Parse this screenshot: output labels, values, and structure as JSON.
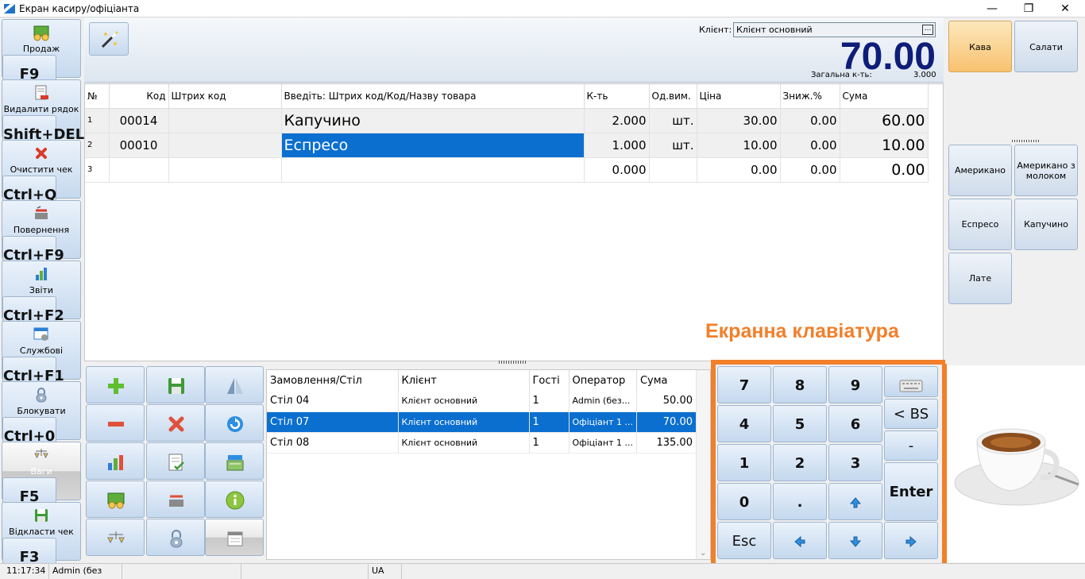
{
  "window": {
    "title": "Екран касиру/офіціанта",
    "minimize": "—",
    "restore": "❐",
    "close": "✕"
  },
  "left_buttons": [
    {
      "label": "Продаж",
      "key": "F9"
    },
    {
      "label": "Видалити рядок",
      "key": "Shift+DEL"
    },
    {
      "label": "Очистити чек",
      "key": "Ctrl+Q"
    },
    {
      "label": "Повернення",
      "key": "Ctrl+F9"
    },
    {
      "label": "Звіти",
      "key": "Ctrl+F2"
    },
    {
      "label": "Службові",
      "key": "Ctrl+F1"
    },
    {
      "label": "Блокувати",
      "key": "Ctrl+0"
    },
    {
      "label": "Ваги",
      "key": "F5"
    },
    {
      "label": "Відкласти чек",
      "key": "F3"
    }
  ],
  "header": {
    "client_label": "Клієнт:",
    "client_value": "Клієнт основний",
    "client_dropdown": "...",
    "total": "70.00",
    "total_qty_label": "Загальна к-ть:",
    "total_qty": "3.000"
  },
  "check_grid": {
    "columns": [
      "№",
      "Код",
      "Штрих код",
      "Введіть: Штрих код/Код/Назву товара",
      "К-ть",
      "Од.вим.",
      "Ціна",
      "Зниж.%",
      "Сума"
    ],
    "rows": [
      {
        "n": "1",
        "code": "00014",
        "barcode": "",
        "name": "Капучино",
        "qty": "2.000",
        "unit": "шт.",
        "price": "30.00",
        "disc": "0.00",
        "sum": "60.00"
      },
      {
        "n": "2",
        "code": "00010",
        "barcode": "",
        "name": "Еспресо",
        "qty": "1.000",
        "unit": "шт.",
        "price": "10.00",
        "disc": "0.00",
        "sum": "10.00"
      },
      {
        "n": "3",
        "code": "",
        "barcode": "",
        "name": "",
        "qty": "0.000",
        "unit": "",
        "price": "0.00",
        "disc": "0.00",
        "sum": "0.00"
      }
    ],
    "selected_row": 2
  },
  "orders": {
    "columns": [
      "Замовлення/Стіл",
      "Клієнт",
      "Гості",
      "Оператор",
      "Сума"
    ],
    "rows": [
      {
        "table": "Стіл 04",
        "client": "Клієнт основний",
        "guests": "1",
        "operator": "Admin (без...",
        "sum": "50.00"
      },
      {
        "table": "Стіл 07",
        "client": "Клієнт основний",
        "guests": "1",
        "operator": "Офіціант 1 ...",
        "sum": "70.00"
      },
      {
        "table": "Стіл 08",
        "client": "Клієнт основний",
        "guests": "1",
        "operator": "Офіціант 1 ...",
        "sum": "135.00"
      }
    ],
    "selected_row": 2,
    "scroll_glyph": "⌄"
  },
  "keyboard": {
    "title": "Екранна клавіатура",
    "keys": {
      "k7": "7",
      "k8": "8",
      "k9": "9",
      "k4": "4",
      "k5": "5",
      "k6": "6",
      "k1": "1",
      "k2": "2",
      "k3": "3",
      "k0": "0",
      "dot": ".",
      "bs": "< BS",
      "minus": "-",
      "enter": "Enter",
      "esc": "Esc"
    }
  },
  "categories": [
    {
      "label": "Кава",
      "active": true
    },
    {
      "label": "Салати",
      "active": false
    }
  ],
  "products": [
    {
      "label": "Американо"
    },
    {
      "label": "Американо з молоком"
    },
    {
      "label": "Еспресо"
    },
    {
      "label": "Капучино"
    },
    {
      "label": "Лате"
    }
  ],
  "status_bar": {
    "time": "11:17:34",
    "user": "Admin (без",
    "layout": "UA"
  },
  "colors": {
    "accent": "#0b6fd0",
    "total": "#0d1d78",
    "highlight": "#f27f2a",
    "active_category": "#f8c16e"
  }
}
